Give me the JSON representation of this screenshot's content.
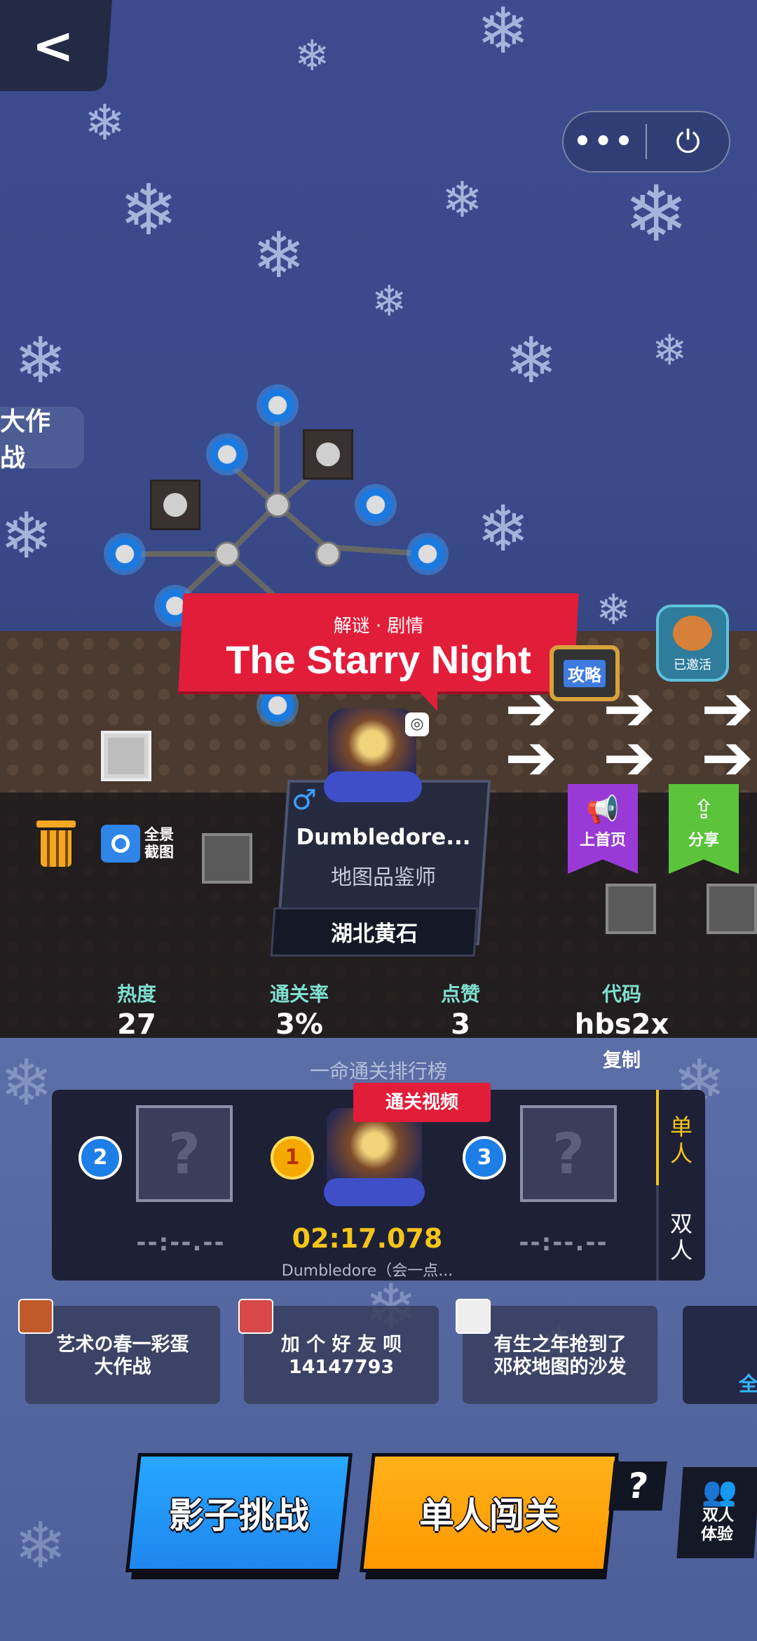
{
  "nav": {
    "back_icon": "chevron-left-icon",
    "more_label": "•••",
    "power_icon": "power-icon",
    "power_glyph": "⏻"
  },
  "side_tag": {
    "label": "大作战"
  },
  "level": {
    "tags": "解谜 · 剧情",
    "title": "The Starry Night",
    "guide_label": "攻略",
    "invite_label": "已邀活"
  },
  "creator": {
    "gender_symbol": "♂",
    "name": "Dumbledore...",
    "title": "地图品鉴师",
    "location": "湖北黄石"
  },
  "tools": {
    "screenshot_label_line1": "全景",
    "screenshot_label_line2": "截图"
  },
  "ribbons": {
    "home_label": "上首页",
    "home_icon": "megaphone-icon",
    "share_label": "分享",
    "share_icon": "share-icon"
  },
  "stats": [
    {
      "key": "热度",
      "value": "27"
    },
    {
      "key": "通关率",
      "value": "3%"
    },
    {
      "key": "点赞",
      "value": "3"
    },
    {
      "key": "代码",
      "value": "hbs2x"
    }
  ],
  "copy_label": "复制",
  "leaderboard": {
    "title": "一命通关排行榜",
    "video_tag": "通关视频",
    "tabs": [
      "单人",
      "双人"
    ],
    "ranks": [
      {
        "rank": "2",
        "time": "--:--.--"
      },
      {
        "rank": "1",
        "time": "02:17.078",
        "player": "Dumbledore（会一点..."
      },
      {
        "rank": "3",
        "time": "--:--.--"
      }
    ],
    "empty_placeholder": "?"
  },
  "comments": [
    {
      "line1": "艺术の春一彩蛋",
      "line2": "大作战"
    },
    {
      "line1": "加 个 好 友 呗",
      "line2": "14147793"
    },
    {
      "line1": "有生之年抢到了",
      "line2": "邓校地图的沙发"
    }
  ],
  "comment_more": "全",
  "buttons": {
    "shadow_challenge": "影子挑战",
    "solo": "单人闯关",
    "help": "?",
    "duo_line1": "双人",
    "duo_line2": "体验"
  }
}
